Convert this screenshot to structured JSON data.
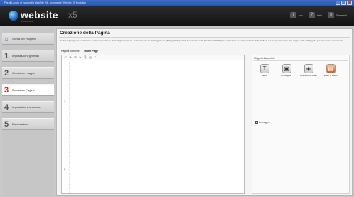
{
  "window": {
    "title": "File di Lavoro di Incomedia WebSite X5 - Incomedia WebSite X5 Evolution"
  },
  "logo": {
    "brand": "website",
    "version": "x5",
    "edition": "EVOLUTION"
  },
  "topnav": [
    {
      "icon": "info-icon",
      "glyph": "i",
      "label": "Info"
    },
    {
      "icon": "help-icon",
      "glyph": "?",
      "label": "Help"
    },
    {
      "icon": "settings-icon",
      "glyph": "≡",
      "label": "Strumenti"
    }
  ],
  "sidebar": {
    "items": [
      {
        "num": "⌂",
        "label": "Scelta del Progetto"
      },
      {
        "num": "1",
        "label": "Impostazioni generali"
      },
      {
        "num": "2",
        "label": "Creazione mappa"
      },
      {
        "num": "3",
        "label": "Creazione Pagine"
      },
      {
        "num": "4",
        "label": "Impostazioni avanzate"
      },
      {
        "num": "5",
        "label": "Esportazione"
      }
    ],
    "active_index": 3
  },
  "main": {
    "title": "Creazione della Pagina",
    "description": "Definisci gli Oggetti da utilizzare per la composizione della Pagina corrente. Seleziona l'icona dell'oggetto tra gli Oggetti disponibili. Posizionala sulla Struttura della Pagina e rilasciala in corrispondenza della Cella in cui vuoi posizionarla. Fai doppio click sull'Oggetto per impostarne i contenuti.",
    "page_select_label": "Pagina corrente:",
    "page_select_value": "Home Page",
    "editor_markers": [
      "1",
      "2"
    ]
  },
  "toolbar_icons": [
    "↶",
    "↷",
    "⊞",
    "✂",
    "⎘",
    "▤",
    "T"
  ],
  "objects_panel": {
    "title": "Oggetti disponibili",
    "objects": [
      {
        "icon": "text-icon",
        "glyph": "T",
        "label": "Testo",
        "accent": false
      },
      {
        "icon": "image-icon",
        "glyph": "▣",
        "label": "Immagine",
        "accent": false
      },
      {
        "icon": "animation-icon",
        "glyph": "◈",
        "label": "Animazione Flash",
        "accent": false
      },
      {
        "icon": "html-code-icon",
        "glyph": "▤",
        "label": "Video & Suoni",
        "accent": true
      }
    ],
    "property_checkbox_label": "Immagine"
  }
}
